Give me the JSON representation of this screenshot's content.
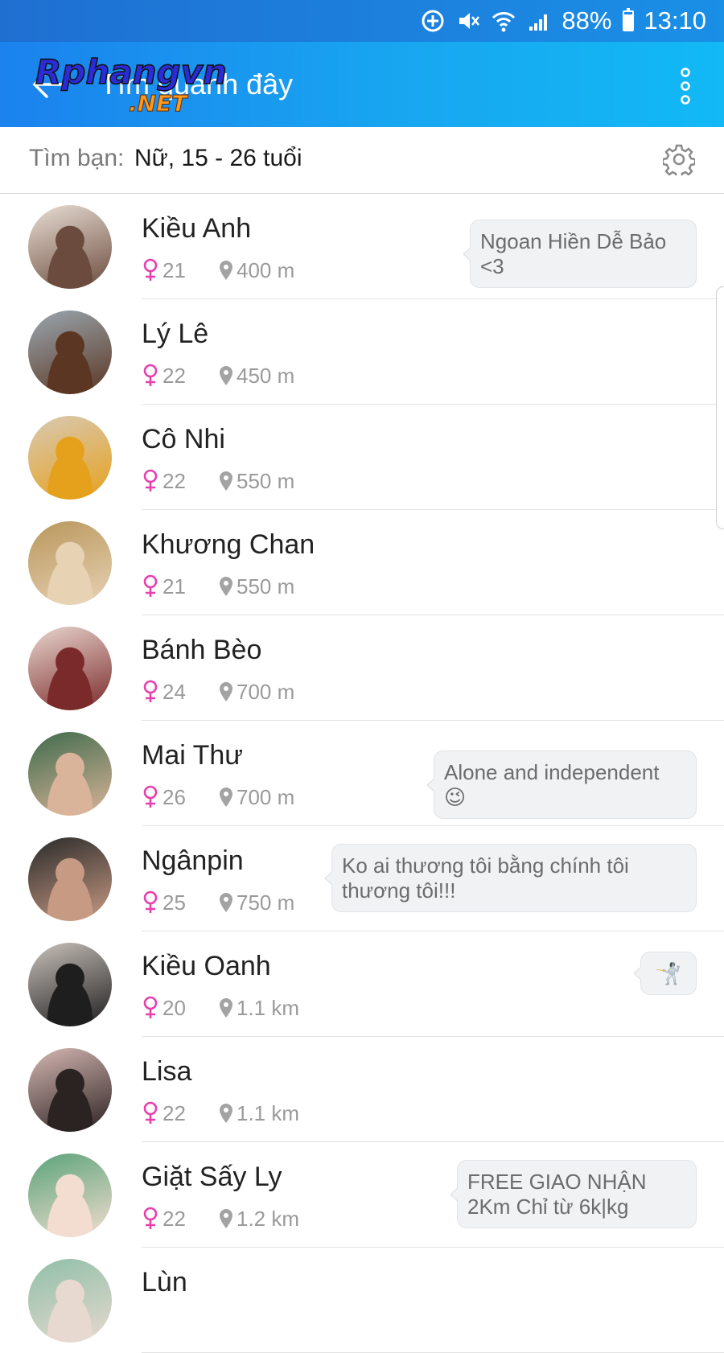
{
  "status_bar": {
    "battery": "88%",
    "battery_level": 0.88,
    "time": "13:10",
    "icons": [
      "data-saver-icon",
      "mute-icon",
      "wifi-icon",
      "signal-icon",
      "battery-icon"
    ]
  },
  "app_bar": {
    "title": "Tìm quanh đây",
    "back_icon": "arrow-left-icon",
    "menu_icon": "more-vertical-icon",
    "watermark": "Rphangvn.NET"
  },
  "filter": {
    "label": "Tìm bạn:",
    "value": "Nữ, 15 - 26 tuổi",
    "icon": "gear-icon"
  },
  "colors": {
    "appbar_start": "#1b82ee",
    "appbar_end": "#12b9f5",
    "female_pink": "#e83fae",
    "meta_gray": "#9a9a9a"
  },
  "users": [
    {
      "name": "Kiều Anh",
      "age": "21",
      "distance": "400 m",
      "status": "Ngoan Hiền Dễ Bảo <3",
      "avatar_colors": [
        "#e9ded5",
        "#6b4b3d"
      ]
    },
    {
      "name": "Lý Lê",
      "age": "22",
      "distance": "450 m",
      "status": "",
      "avatar_colors": [
        "#9aa7b0",
        "#5b3622"
      ]
    },
    {
      "name": "Cô Nhi",
      "age": "22",
      "distance": "550 m",
      "status": "",
      "avatar_colors": [
        "#d8c9b4",
        "#e6a11c"
      ]
    },
    {
      "name": "Khương Chan",
      "age": "21",
      "distance": "550 m",
      "status": "",
      "avatar_colors": [
        "#b9975c",
        "#e7d2b4"
      ]
    },
    {
      "name": "Bánh Bèo",
      "age": "24",
      "distance": "700 m",
      "status": "",
      "avatar_colors": [
        "#e9d6cf",
        "#7a2a2a"
      ]
    },
    {
      "name": "Mai Thư",
      "age": "26",
      "distance": "700 m",
      "status": "Alone and independent 😉",
      "avatar_colors": [
        "#3f6b4b",
        "#d9b49a"
      ]
    },
    {
      "name": "Ngânpin",
      "age": "25",
      "distance": "750 m",
      "status": "Ko ai thương tôi bằng chính tôi thương tôi!!!",
      "avatar_colors": [
        "#2a2a2a",
        "#c79a83"
      ]
    },
    {
      "name": "Kiều Oanh",
      "age": "20",
      "distance": "1.1 km",
      "status": "🤺",
      "avatar_colors": [
        "#c9c1bb",
        "#1e1e1e"
      ]
    },
    {
      "name": "Lisa",
      "age": "22",
      "distance": "1.1 km",
      "status": "",
      "avatar_colors": [
        "#d6b8b3",
        "#2b2222"
      ]
    },
    {
      "name": "Giặt Sấy Ly",
      "age": "22",
      "distance": "1.2 km",
      "status": "FREE GIAO NHẬN 2Km Chỉ từ 6k|kg",
      "avatar_colors": [
        "#5aa37a",
        "#f3ddd0"
      ]
    },
    {
      "name": "Lùn",
      "age": "",
      "distance": "",
      "status": "",
      "avatar_colors": [
        "#8fbfa8",
        "#e7d9cf"
      ]
    }
  ]
}
